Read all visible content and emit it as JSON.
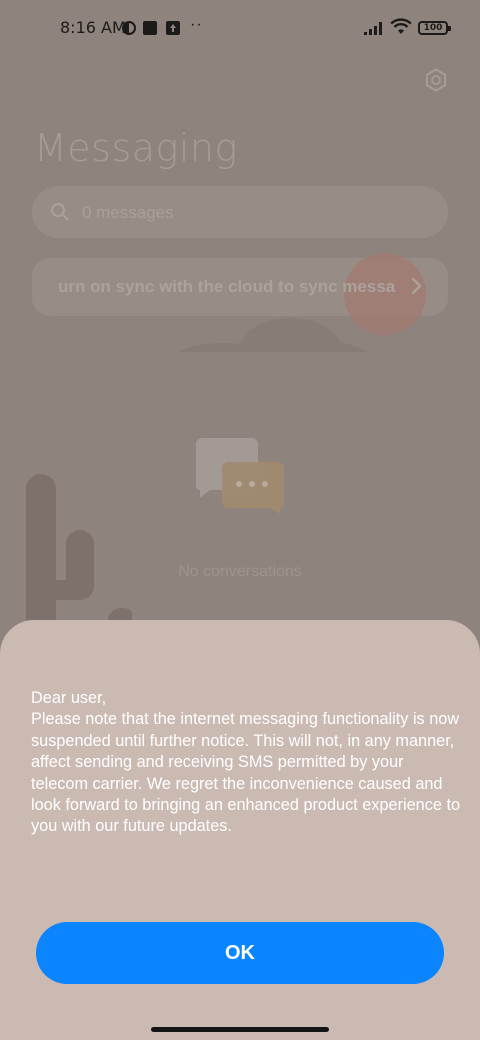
{
  "status_bar": {
    "time": "8:16 AM",
    "dots": "··",
    "battery": "100"
  },
  "header": {
    "title": "Messaging",
    "settings_icon": "gear-icon"
  },
  "search": {
    "placeholder": "0 messages"
  },
  "sync_banner": {
    "text": "urn on sync with the cloud to sync messages"
  },
  "empty_state": {
    "text": "No conversations"
  },
  "dialog": {
    "message": "Dear user,\nPlease note that the internet messaging functionality is now suspended until further notice. This will not, in any manner, affect sending and receiving SMS permitted by your telecom carrier. We regret the inconvenience caused and look forward to bringing an enhanced product experience to you with our future updates.",
    "ok_label": "OK"
  },
  "colors": {
    "accent": "#0a84ff",
    "sheet_background": "#cbbab2",
    "dimmed_background": "#8e837d"
  }
}
